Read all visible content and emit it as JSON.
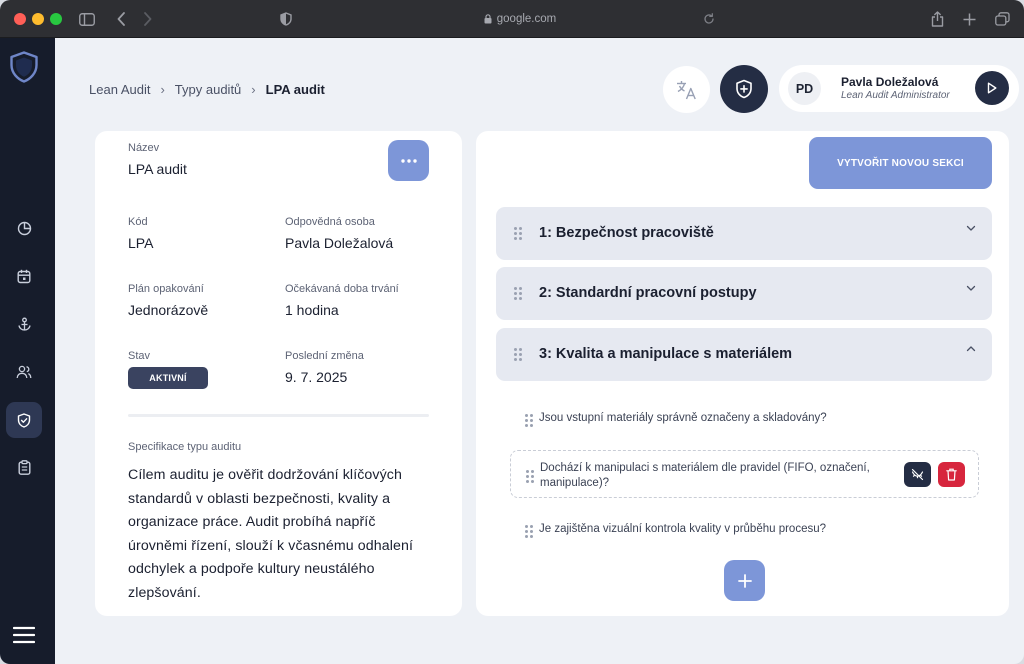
{
  "browser": {
    "url": "google.com"
  },
  "sidebar": {
    "items": [
      {
        "icon": "pie-chart-icon"
      },
      {
        "icon": "calendar-icon"
      },
      {
        "icon": "anchor-icon"
      },
      {
        "icon": "users-icon"
      },
      {
        "icon": "shield-check-icon",
        "active": true
      },
      {
        "icon": "clipboard-icon"
      }
    ]
  },
  "breadcrumb": {
    "items": [
      "Lean Audit",
      "Typy auditů",
      "LPA audit"
    ]
  },
  "user": {
    "initials": "PD",
    "name": "Pavla Doležalová",
    "role": "Lean Audit Administrator"
  },
  "detail": {
    "name_label": "Název",
    "name_value": "LPA audit",
    "code_label": "Kód",
    "code_value": "LPA",
    "owner_label": "Odpovědná osoba",
    "owner_value": "Pavla Doležalová",
    "repeat_label": "Plán opakování",
    "repeat_value": "Jednorázově",
    "duration_label": "Očekávaná doba trvání",
    "duration_value": "1 hodina",
    "status_label": "Stav",
    "status_value": "AKTIVNÍ",
    "changed_label": "Poslední změna",
    "changed_value": "9. 7. 2025",
    "spec_label": "Specifikace typu auditu",
    "spec_text": "Cílem auditu je ověřit dodržování klíčových standardů v oblasti bezpečnosti, kvality a organizace práce. Audit probíhá napříč úrovněmi řízení, slouží k včasnému odhalení odchylek a podpoře kultury neustálého zlepšování."
  },
  "sections_panel": {
    "new_section_label": "VYTVOŘIT NOVOU SEKCI",
    "sections": [
      {
        "title": "1: Bezpečnost pracoviště",
        "expanded": false
      },
      {
        "title": "2: Standardní pracovní postupy",
        "expanded": false
      },
      {
        "title": "3: Kvalita a manipulace s materiálem",
        "expanded": true
      }
    ],
    "questions": [
      "Jsou vstupní materiály správně označeny a skladovány?",
      "Dochází k manipulaci s materiálem dle pravidel (FIFO, označení, manipulace)?",
      "Je zajištěna vizuální kontrola kvality v průběhu procesu?"
    ]
  },
  "colors": {
    "sidebar": "#161c2b",
    "accent": "#7d96d8",
    "dark_button": "#242d44",
    "danger": "#d7263d",
    "section_bg": "#e6e9f1"
  }
}
